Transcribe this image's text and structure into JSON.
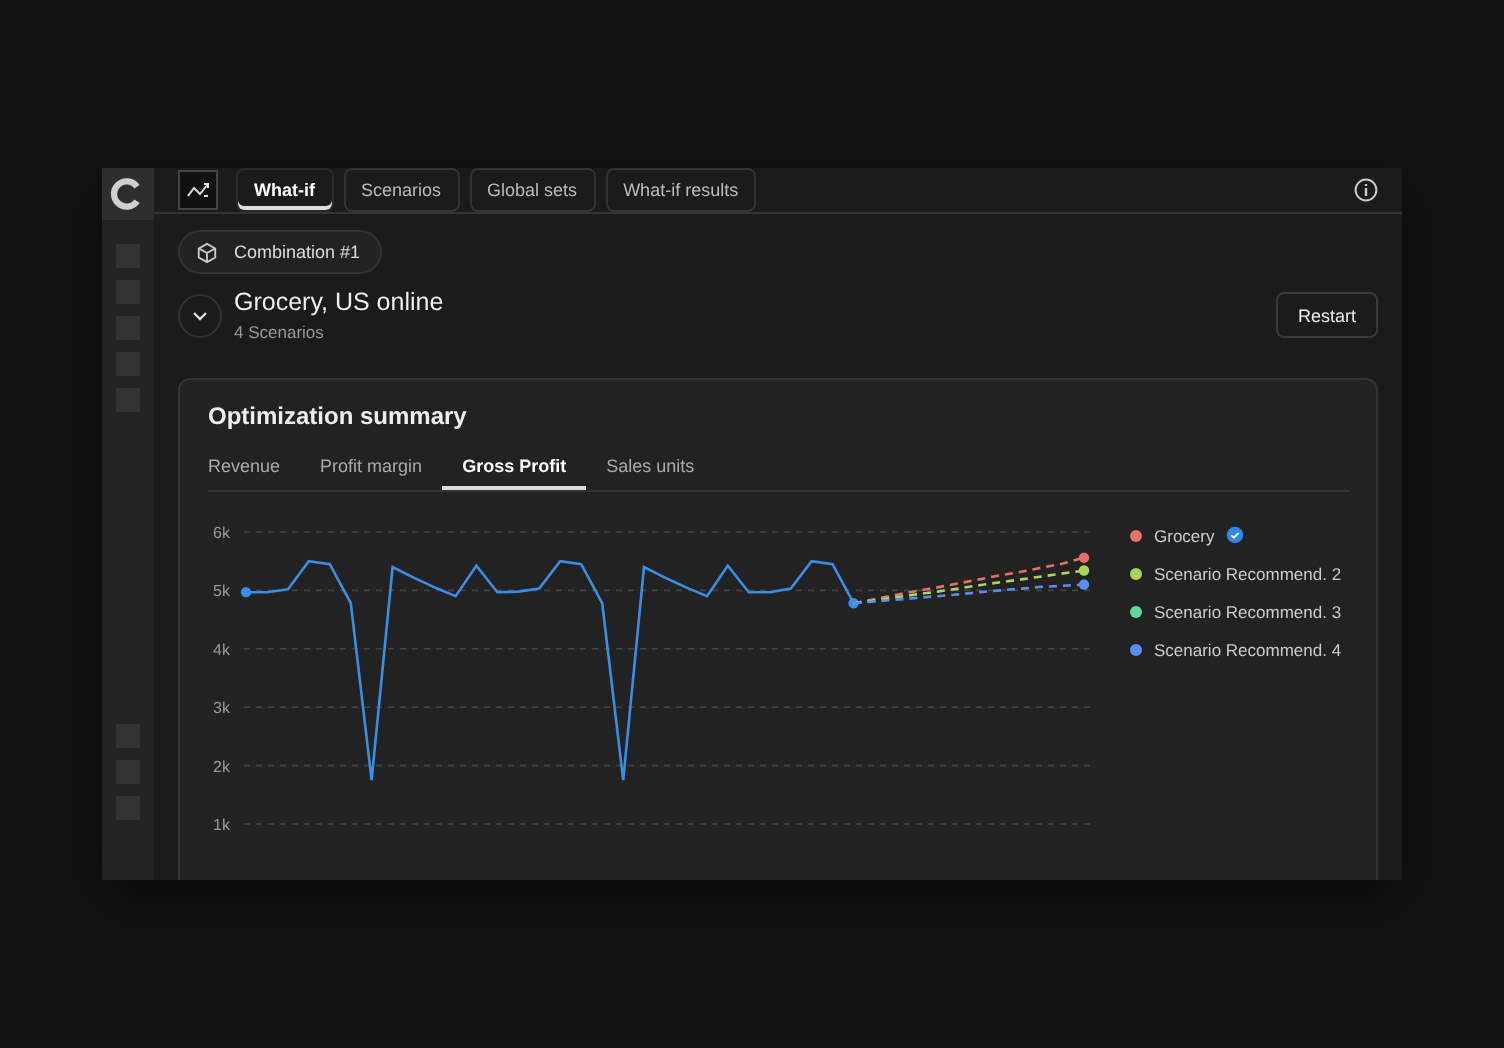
{
  "header": {
    "tabs": [
      {
        "label": "What-if",
        "selected": true
      },
      {
        "label": "Scenarios",
        "selected": false
      },
      {
        "label": "Global sets",
        "selected": false
      },
      {
        "label": "What-if results",
        "selected": false
      }
    ]
  },
  "combination": {
    "label": "Combination #1"
  },
  "group": {
    "title": "Grocery, US online",
    "subtitle": "4 Scenarios",
    "expanded": true,
    "button": "Restart"
  },
  "summary": {
    "title": "Optimization summary",
    "tabs": [
      {
        "label": "Revenue",
        "selected": false
      },
      {
        "label": "Profit margin",
        "selected": false
      },
      {
        "label": "Gross Profit",
        "selected": true
      },
      {
        "label": "Sales units",
        "selected": false
      }
    ],
    "legend_items": [
      {
        "verified": true
      },
      {
        "verified": false
      },
      {
        "verified": false
      },
      {
        "verified": false
      }
    ],
    "chart_data": {
      "type": "line",
      "grid": true,
      "legend": true,
      "ylim": [
        1,
        6
      ],
      "yticks": [
        {
          "value": 1,
          "label": "1k"
        },
        {
          "value": 2,
          "label": "2k"
        },
        {
          "value": 3,
          "label": "3k"
        },
        {
          "value": 4,
          "label": "4k"
        },
        {
          "value": 5,
          "label": "5k"
        },
        {
          "value": 6,
          "label": "6k"
        }
      ],
      "series": [
        {
          "color": "#3b8ee6",
          "line_style": "solid",
          "values": [
            4.97,
            4.97,
            5.02,
            5.5,
            5.45,
            4.78,
            1.75,
            5.4,
            5.22,
            5.05,
            4.9,
            5.42,
            4.97,
            4.98,
            5.03,
            5.5,
            5.45,
            4.78,
            1.75,
            5.4,
            5.22,
            5.05,
            4.9,
            5.42,
            4.97,
            4.97,
            5.03,
            5.5,
            5.45,
            4.78,
            null,
            null,
            null,
            null,
            null,
            null,
            null,
            null,
            null,
            null,
            null
          ]
        },
        {
          "name": "Grocery",
          "color": "#e8706a",
          "line_style": "dashed",
          "values": [
            null,
            null,
            null,
            null,
            null,
            null,
            null,
            null,
            null,
            null,
            null,
            null,
            null,
            null,
            null,
            null,
            null,
            null,
            null,
            null,
            null,
            null,
            null,
            null,
            null,
            null,
            null,
            null,
            null,
            4.78,
            4.85,
            4.92,
            4.99,
            5.05,
            5.12,
            5.19,
            5.26,
            5.32,
            5.39,
            5.46,
            5.56
          ]
        },
        {
          "name": "Scenario Recommend. 2",
          "color": "#a9d65a",
          "line_style": "dashed",
          "values": [
            null,
            null,
            null,
            null,
            null,
            null,
            null,
            null,
            null,
            null,
            null,
            null,
            null,
            null,
            null,
            null,
            null,
            null,
            null,
            null,
            null,
            null,
            null,
            null,
            null,
            null,
            null,
            null,
            null,
            4.78,
            4.83,
            4.88,
            4.93,
            4.98,
            5.03,
            5.09,
            5.14,
            5.19,
            5.24,
            5.29,
            5.34
          ]
        },
        {
          "name": "Scenario Recommend. 3",
          "color": "#5fd8a0",
          "line_style": "dashed",
          "values": [
            null,
            null,
            null,
            null,
            null,
            null,
            null,
            null,
            null,
            null,
            null,
            null,
            null,
            null,
            null,
            null,
            null,
            null,
            null,
            null,
            null,
            null,
            null,
            null,
            null,
            null,
            null,
            null,
            null,
            null,
            null,
            null,
            null,
            null,
            null,
            null,
            null,
            null,
            null,
            null,
            null
          ]
        },
        {
          "name": "Scenario Recommend. 4",
          "color": "#5b8def",
          "line_style": "dashed",
          "values": [
            null,
            null,
            null,
            null,
            null,
            null,
            null,
            null,
            null,
            null,
            null,
            null,
            null,
            null,
            null,
            null,
            null,
            null,
            null,
            null,
            null,
            null,
            null,
            null,
            null,
            null,
            null,
            null,
            null,
            4.78,
            4.81,
            4.84,
            4.87,
            4.9,
            4.93,
            4.97,
            5.0,
            5.03,
            5.06,
            5.08,
            5.1
          ]
        }
      ]
    }
  }
}
